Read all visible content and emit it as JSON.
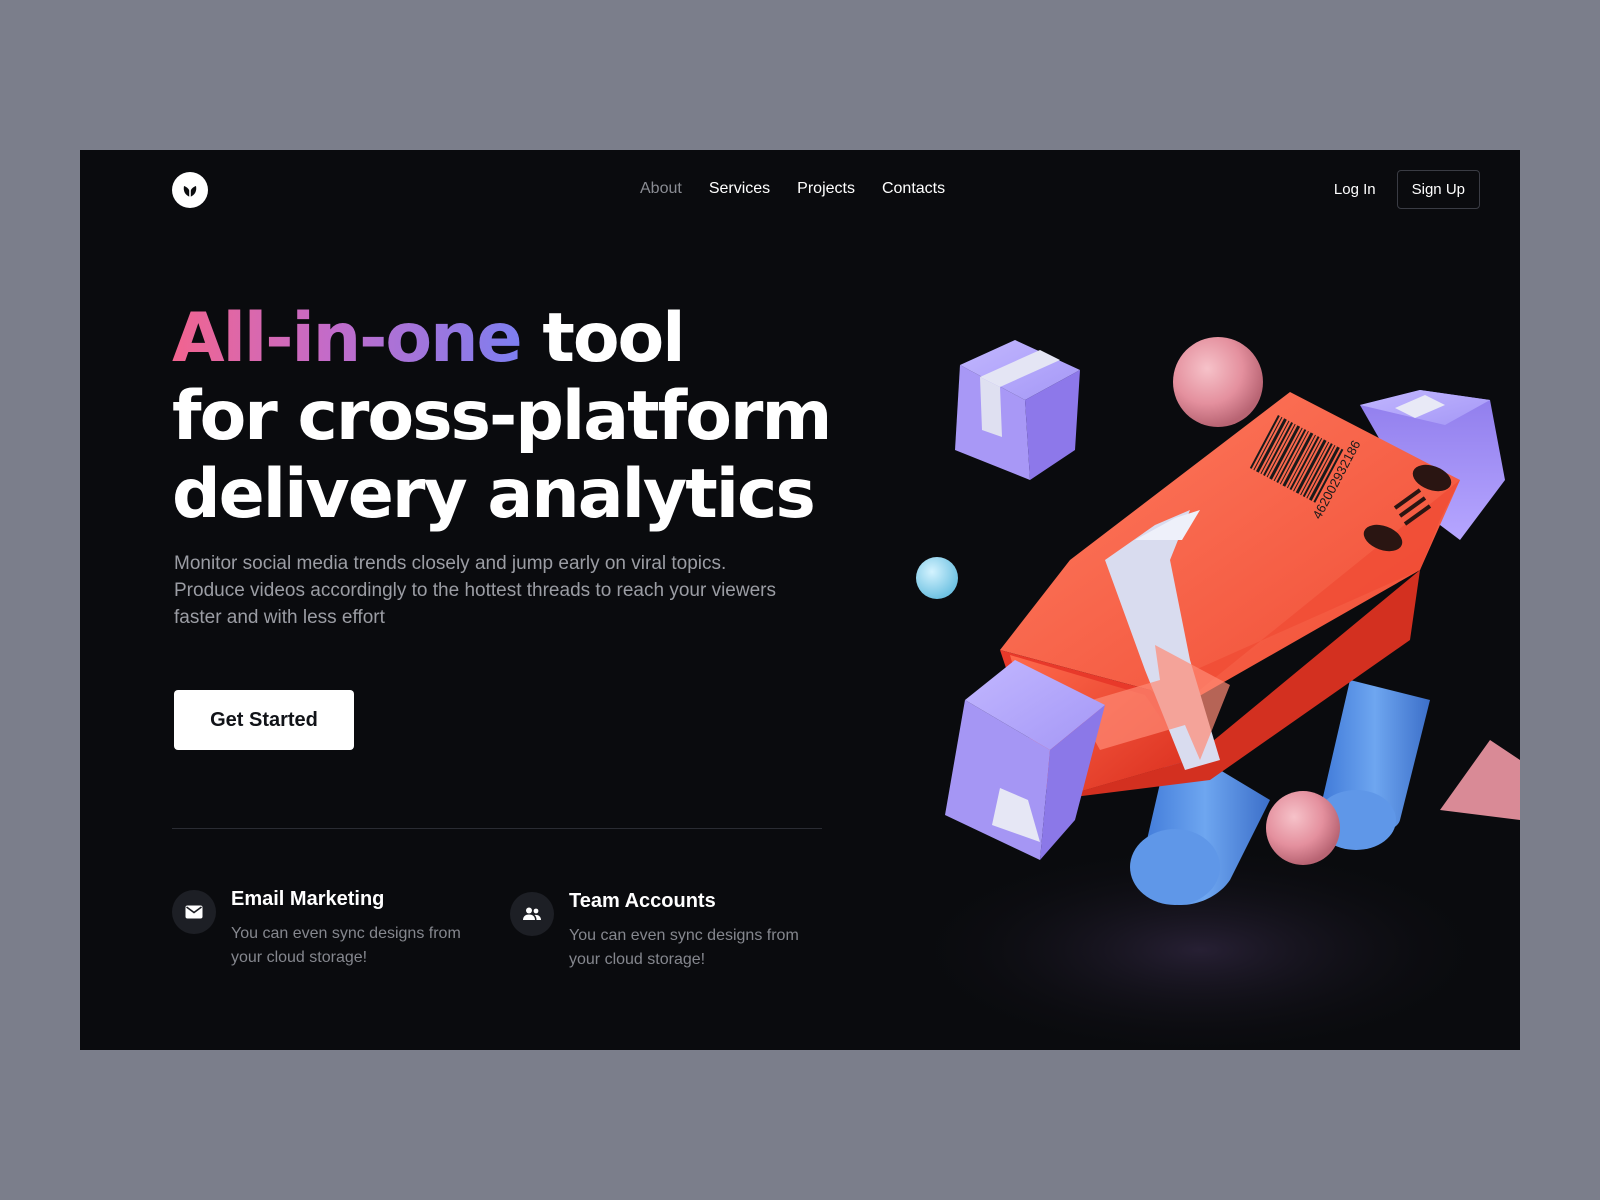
{
  "nav": {
    "items": [
      {
        "label": "About",
        "active": false
      },
      {
        "label": "Services",
        "active": true
      },
      {
        "label": "Projects",
        "active": true
      },
      {
        "label": "Contacts",
        "active": true
      }
    ]
  },
  "auth": {
    "login_label": "Log In",
    "signup_label": "Sign Up"
  },
  "hero": {
    "headline_gradient": "All-in-one",
    "headline_rest": " tool",
    "headline_line2": "for cross-platform",
    "headline_line3": "delivery analytics",
    "subtitle": "Monitor social media trends closely and jump early on viral topics. Produce videos accordingly to the hottest threads to reach your viewers faster and with less effort",
    "cta_label": "Get Started"
  },
  "features": [
    {
      "icon": "mail-icon",
      "title": "Email Marketing",
      "description": "You can even sync designs from your cloud storage!"
    },
    {
      "icon": "users-icon",
      "title": "Team Accounts",
      "description": "You can even sync designs from your cloud storage!"
    }
  ],
  "illustration": {
    "barcode_number": "462002932186"
  },
  "colors": {
    "background": "#0a0b0e",
    "gradient_start": "#f2648f",
    "gradient_end": "#7d7ff0",
    "box_red": "#e8392a",
    "box_purple": "#9b8cf2",
    "cylinder_blue": "#5a93e4",
    "sphere_pink": "#e3909f",
    "sphere_cyan": "#8fd6ef"
  }
}
